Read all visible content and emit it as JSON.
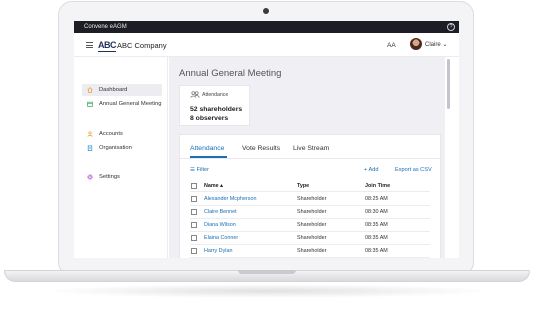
{
  "app": {
    "title": "Convene eAGM",
    "help_glyph": "?"
  },
  "header": {
    "logo": "ABC",
    "company": "ABC Company",
    "text_size": "AA",
    "user": "Claire",
    "user_caret": "⌄"
  },
  "sidebar": {
    "items": [
      {
        "label": "Dashboard",
        "icon": "house-icon",
        "active": true
      },
      {
        "label": "Annual General Meeting",
        "icon": "calendar-icon",
        "active": false
      },
      {
        "label": "Accounts",
        "icon": "person-icon",
        "active": false
      },
      {
        "label": "Organisation",
        "icon": "building-icon",
        "active": false
      },
      {
        "label": "Settings",
        "icon": "gear-icon",
        "active": false
      }
    ]
  },
  "main": {
    "title": "Annual General Meeting",
    "attendance_card": {
      "caption": "Attendance",
      "shareholders": "52 shareholders",
      "observers": "8 observers"
    },
    "tabs": [
      {
        "label": "Attendance",
        "active": true
      },
      {
        "label": "Vote Results",
        "active": false
      },
      {
        "label": "Live Stream",
        "active": false
      }
    ],
    "actions": {
      "filter": "Filter",
      "add": "+ Add",
      "export": "Export as CSV"
    },
    "table": {
      "headers": {
        "name": "Name ▴",
        "type": "Type",
        "time": "Join Time"
      },
      "rows": [
        {
          "name": "Alexander Mcpherson",
          "type": "Shareholder",
          "time": "08:25 AM"
        },
        {
          "name": "Claire Bennet",
          "type": "Shareholder",
          "time": "08:30 AM"
        },
        {
          "name": "Diana Wilson",
          "type": "Shareholder",
          "time": "08:35 AM"
        },
        {
          "name": "Elaina Conner",
          "type": "Shareholder",
          "time": "08:35 AM"
        },
        {
          "name": "Harry Dylan",
          "type": "Shareholder",
          "time": "08:35 AM"
        }
      ]
    }
  },
  "colors": {
    "accent": "#1a6fb5",
    "titlebar": "#1d1d26",
    "nav_active": "#ececf1"
  }
}
